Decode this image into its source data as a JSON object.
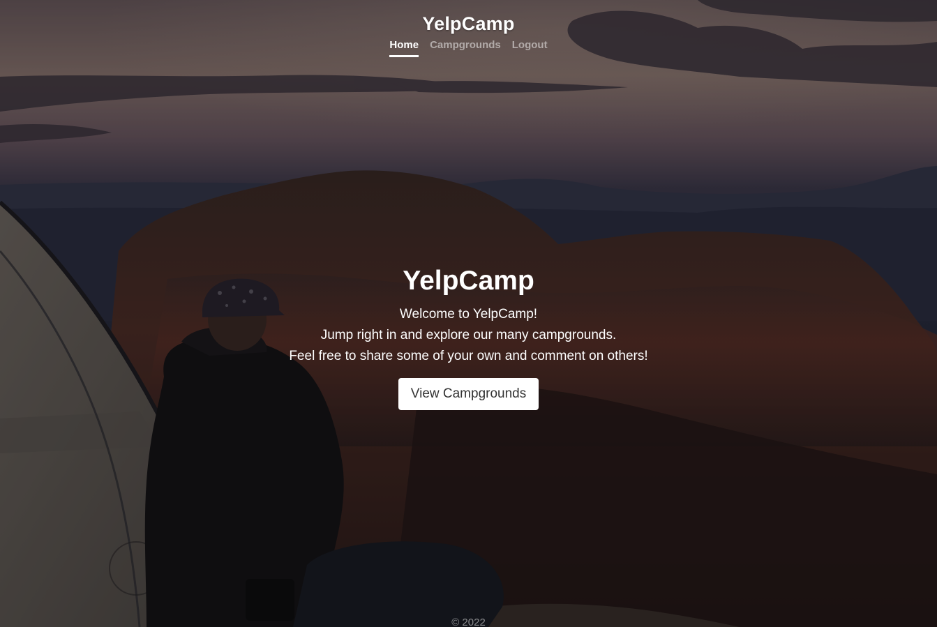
{
  "header": {
    "brand": "YelpCamp",
    "nav": [
      {
        "label": "Home",
        "active": true
      },
      {
        "label": "Campgrounds",
        "active": false
      },
      {
        "label": "Logout",
        "active": false
      }
    ]
  },
  "cover": {
    "title": "YelpCamp",
    "lines": [
      "Welcome to YelpCamp!",
      "Jump right in and explore our many campgrounds.",
      "Feel free to share some of your own and comment on others!"
    ],
    "cta_label": "View Campgrounds"
  },
  "footer": {
    "copyright": "© 2022"
  },
  "colors": {
    "text": "#ffffff",
    "muted_text": "rgba(255,255,255,0.5)",
    "button_bg": "#ffffff",
    "button_text": "#333333"
  }
}
